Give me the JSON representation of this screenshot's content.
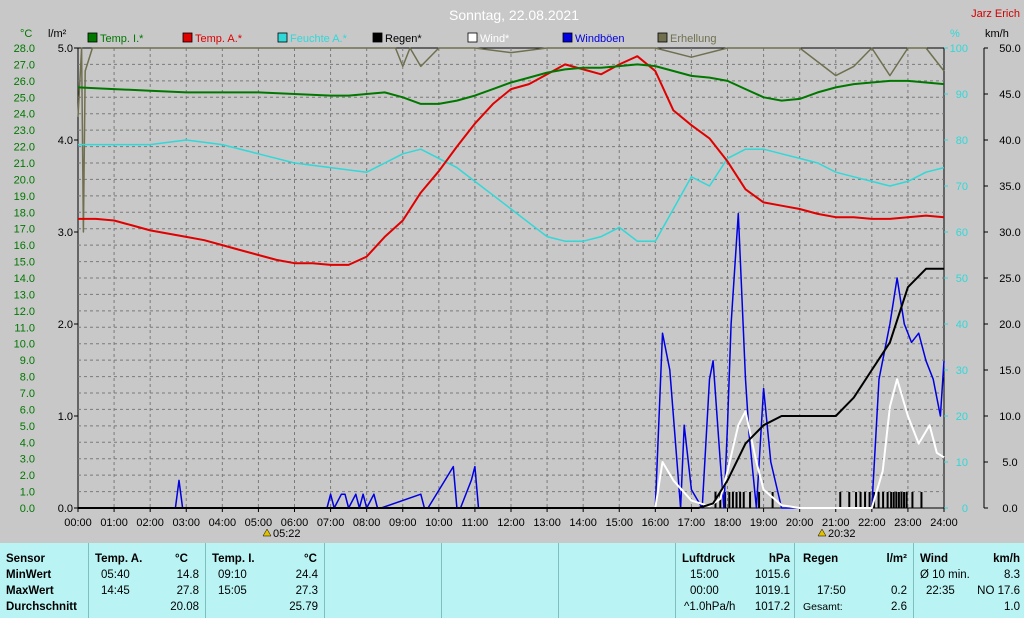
{
  "header": {
    "title": "Sonntag, 22.08.2021",
    "author": "Jarz Erich",
    "unit_left_temp": "°C",
    "unit_left_rain": "l/m²",
    "unit_right_hum": "%",
    "unit_right_wind": "km/h"
  },
  "colors": {
    "temp_in": "#007800",
    "temp_out": "#e00000",
    "humidity": "#30d8d8",
    "rain": "#000000",
    "wind": "#ffffff",
    "gust": "#0000e0",
    "brightness": "#707050",
    "table_bg": "#b9f3f3",
    "chart_bg": "#c8c8c8"
  },
  "legend": [
    {
      "label": "Temp. I.*",
      "color": "#007800"
    },
    {
      "label": "Temp. A.*",
      "color": "#e00000"
    },
    {
      "label": "Feuchte A.*",
      "color": "#30d8d8"
    },
    {
      "label": "Regen*",
      "color": "#000000"
    },
    {
      "label": "Wind*",
      "color": "#ffffff"
    },
    {
      "label": "Windböen",
      "color": "#0000e0"
    },
    {
      "label": "Erhellung",
      "color": "#707050"
    }
  ],
  "sun": {
    "sunrise": "05:22",
    "sunset": "20:32"
  },
  "chart_data": {
    "type": "line",
    "title": "Sonntag, 22.08.2021",
    "x_labels": [
      "00:00",
      "01:00",
      "02:00",
      "03:00",
      "04:00",
      "05:00",
      "06:00",
      "07:00",
      "08:00",
      "09:00",
      "10:00",
      "11:00",
      "12:00",
      "13:00",
      "14:00",
      "15:00",
      "16:00",
      "17:00",
      "18:00",
      "19:00",
      "20:00",
      "21:00",
      "22:00",
      "23:00",
      "24:00"
    ],
    "xlim": [
      0,
      24
    ],
    "axes": {
      "temp": {
        "unit": "°C",
        "range": [
          0,
          28
        ],
        "ticks": [
          "0.0",
          "1.0",
          "2.0",
          "3.0",
          "4.0",
          "5.0",
          "6.0",
          "7.0",
          "8.0",
          "9.0",
          "10.0",
          "11.0",
          "12.0",
          "13.0",
          "14.0",
          "15.0",
          "16.0",
          "17.0",
          "18.0",
          "19.0",
          "20.0",
          "21.0",
          "22.0",
          "23.0",
          "24.0",
          "25.0",
          "26.0",
          "27.0",
          "28.0"
        ]
      },
      "rain": {
        "unit": "l/m²",
        "range": [
          0,
          5
        ],
        "ticks": [
          "0.0",
          "1.0",
          "2.0",
          "3.0",
          "4.0",
          "5.0"
        ]
      },
      "humidity": {
        "unit": "%",
        "range": [
          0,
          100
        ],
        "ticks": [
          "0",
          "10",
          "20",
          "30",
          "40",
          "50",
          "60",
          "70",
          "80",
          "90",
          "100"
        ]
      },
      "wind": {
        "unit": "km/h",
        "range": [
          0,
          50
        ],
        "ticks": [
          "0.0",
          "5.0",
          "10.0",
          "15.0",
          "20.0",
          "25.0",
          "30.0",
          "35.0",
          "40.0",
          "45.0",
          "50.0"
        ]
      }
    },
    "grid": true,
    "series": [
      {
        "name": "Temp. I.*",
        "axis": "temp",
        "color": "#007800",
        "x": [
          0,
          1,
          2,
          3,
          4,
          5,
          6,
          7,
          7.5,
          8,
          8.5,
          9,
          9.5,
          10,
          10.5,
          11,
          11.5,
          12,
          12.5,
          13,
          13.5,
          14,
          14.5,
          15,
          15.5,
          16,
          16.5,
          17,
          17.5,
          18,
          18.5,
          19,
          19.5,
          20,
          20.5,
          21,
          21.5,
          22,
          22.5,
          23,
          23.5,
          24
        ],
        "y": [
          25.6,
          25.5,
          25.4,
          25.3,
          25.3,
          25.3,
          25.2,
          25.1,
          25.1,
          25.2,
          25.3,
          25.0,
          24.6,
          24.6,
          24.8,
          25.1,
          25.5,
          25.9,
          26.2,
          26.5,
          26.7,
          26.8,
          26.8,
          26.9,
          27.0,
          26.9,
          26.6,
          26.3,
          26.2,
          26.0,
          25.5,
          25.0,
          24.8,
          24.9,
          25.3,
          25.6,
          25.8,
          25.9,
          26.0,
          26.0,
          25.9,
          25.8
        ]
      },
      {
        "name": "Temp. A.*",
        "axis": "temp",
        "color": "#e00000",
        "x": [
          0,
          0.5,
          1,
          1.5,
          2,
          2.5,
          3,
          3.5,
          4,
          4.5,
          5,
          5.5,
          6,
          6.5,
          7,
          7.5,
          8,
          8.5,
          9,
          9.5,
          10,
          10.5,
          11,
          11.5,
          12,
          12.5,
          13,
          13.5,
          14,
          14.5,
          15,
          15.5,
          16,
          16.5,
          17,
          17.5,
          18,
          18.5,
          19,
          19.5,
          20,
          20.5,
          21,
          21.5,
          22,
          22.5,
          23,
          23.5,
          24
        ],
        "y": [
          17.6,
          17.6,
          17.5,
          17.2,
          16.9,
          16.7,
          16.5,
          16.3,
          16.0,
          15.7,
          15.4,
          15.1,
          14.9,
          14.9,
          14.8,
          14.8,
          15.3,
          16.5,
          17.5,
          19.2,
          20.5,
          22.0,
          23.4,
          24.6,
          25.5,
          25.8,
          26.4,
          27.0,
          26.7,
          26.4,
          27.0,
          27.5,
          26.6,
          24.2,
          23.3,
          22.5,
          21.1,
          19.4,
          18.6,
          18.4,
          18.2,
          17.9,
          17.7,
          17.7,
          17.6,
          17.6,
          17.7,
          17.8,
          17.7
        ]
      },
      {
        "name": "Feuchte A.*",
        "axis": "humidity",
        "color": "#30d8d8",
        "x": [
          0,
          1,
          2,
          3,
          4,
          5,
          6,
          7,
          8,
          9,
          9.5,
          10,
          10.5,
          11,
          11.5,
          12,
          12.5,
          13,
          13.5,
          14,
          14.5,
          15,
          15.5,
          16,
          16.5,
          17,
          17.5,
          18,
          18.5,
          19,
          19.5,
          20,
          20.5,
          21,
          21.5,
          22,
          22.5,
          23,
          23.5,
          24
        ],
        "y": [
          79,
          79,
          79,
          80,
          79,
          77,
          75,
          74,
          73,
          77,
          78,
          76,
          74,
          71,
          68,
          65,
          62,
          59,
          58,
          58,
          59,
          61,
          58,
          58,
          65,
          72,
          70,
          76,
          78,
          78,
          77,
          76,
          75,
          73,
          72,
          71,
          70,
          71,
          73,
          74
        ]
      },
      {
        "name": "Regen*",
        "axis": "rain",
        "color": "#000000",
        "x": [
          0,
          17.2,
          17.6,
          18,
          18.5,
          19,
          19.5,
          20,
          20.5,
          21,
          21.5,
          22,
          22.5,
          23,
          23.5,
          24
        ],
        "y": [
          0,
          0,
          0.05,
          0.3,
          0.7,
          0.9,
          1.0,
          1.0,
          1.0,
          1.0,
          1.2,
          1.5,
          1.8,
          2.4,
          2.6,
          2.6
        ]
      },
      {
        "name": "Wind*",
        "axis": "wind",
        "color": "#ffffff",
        "x": [
          0,
          16,
          16.2,
          16.5,
          17,
          17.5,
          17.8,
          18,
          18.3,
          18.5,
          18.8,
          19,
          19.5,
          20,
          22,
          22.3,
          22.5,
          22.7,
          23,
          23.3,
          23.6,
          23.8,
          24
        ],
        "y": [
          0,
          0,
          5.0,
          3.0,
          0.8,
          0.2,
          1.0,
          4.0,
          9.0,
          10.5,
          5.0,
          2.0,
          0.3,
          0,
          0,
          4.0,
          11.0,
          14.0,
          10.0,
          7.0,
          9.0,
          6.0,
          5.5
        ]
      },
      {
        "name": "Windböen",
        "axis": "wind",
        "color": "#0000e0",
        "x": [
          0,
          2.7,
          2.8,
          2.9,
          3.0,
          6.9,
          7.0,
          7.1,
          7.3,
          7.4,
          7.5,
          7.7,
          7.8,
          7.9,
          8.0,
          8.2,
          8.3,
          8.4,
          9.5,
          9.6,
          9.7,
          10.4,
          10.5,
          10.6,
          10.9,
          11.0,
          11.1,
          11.2,
          11.3,
          16.0,
          16.2,
          16.4,
          16.7,
          16.8,
          17.0,
          17.3,
          17.5,
          17.6,
          17.8,
          17.9,
          18.0,
          18.1,
          18.3,
          18.5,
          18.6,
          18.8,
          19.0,
          19.2,
          19.5,
          22.0,
          22.2,
          22.5,
          22.7,
          22.9,
          23.1,
          23.3,
          23.5,
          23.7,
          23.9,
          24
        ],
        "y": [
          0,
          0,
          3.0,
          0,
          0,
          0,
          1.5,
          0,
          1.5,
          1.5,
          0,
          1.5,
          0,
          1.5,
          0,
          1.5,
          0,
          0,
          1.5,
          0,
          0,
          4.5,
          0,
          0,
          3,
          4.5,
          0,
          0,
          0,
          0,
          19,
          15,
          0,
          9,
          2,
          0,
          14,
          16,
          5,
          0,
          9,
          20,
          32,
          14,
          8,
          0,
          13,
          5,
          0,
          0,
          14,
          20,
          25,
          20,
          18,
          19,
          16,
          14,
          10,
          16
        ]
      },
      {
        "name": "Erhellung",
        "axis": "humidity",
        "color": "#707050",
        "x": [
          0,
          0.1,
          0.15,
          0.2,
          0.4,
          8.8,
          9.0,
          9.2,
          9.5,
          10,
          11,
          12,
          13,
          14,
          15,
          16,
          17,
          18,
          19,
          20,
          21,
          21.5,
          22,
          22.5,
          23,
          23.5,
          24
        ],
        "y": [
          85,
          100,
          60,
          95,
          100,
          100,
          96,
          100,
          96,
          100,
          100,
          99,
          100,
          100,
          100,
          100,
          98,
          100,
          100,
          100,
          94,
          96,
          100,
          94,
          100,
          100,
          95
        ]
      }
    ]
  },
  "table": {
    "sensor": {
      "header": "Sensor",
      "rows": [
        "MinWert",
        "MaxWert",
        "Durchschnitt"
      ]
    },
    "temp_a": {
      "header": "Temp. A.",
      "unit": "°C",
      "min_time": "05:40",
      "min_val": "14.8",
      "max_time": "14:45",
      "max_val": "27.8",
      "avg": "20.08"
    },
    "temp_i": {
      "header": "Temp. I.",
      "unit": "°C",
      "min_time": "09:10",
      "min_val": "24.4",
      "max_time": "15:05",
      "max_val": "27.3",
      "avg": "25.79"
    },
    "pressure": {
      "header": "Luftdruck",
      "unit": "hPa",
      "min_time": "15:00",
      "min_val": "1015.6",
      "max_time": "00:00",
      "max_val": "1019.1",
      "avg_label": "^1.0hPa/h",
      "avg": "1017.2"
    },
    "rain": {
      "header": "Regen",
      "unit": "l/m²",
      "max_time": "17:50",
      "max_val": "0.2",
      "avg_label": "Gesamt:",
      "avg": "2.6"
    },
    "wind": {
      "header": "Wind",
      "unit": "km/h",
      "min_label": "Ø 10 min.",
      "min_val": "8.3",
      "max_time": "22:35",
      "max_val": "NO 17.6",
      "avg": "1.0"
    }
  }
}
